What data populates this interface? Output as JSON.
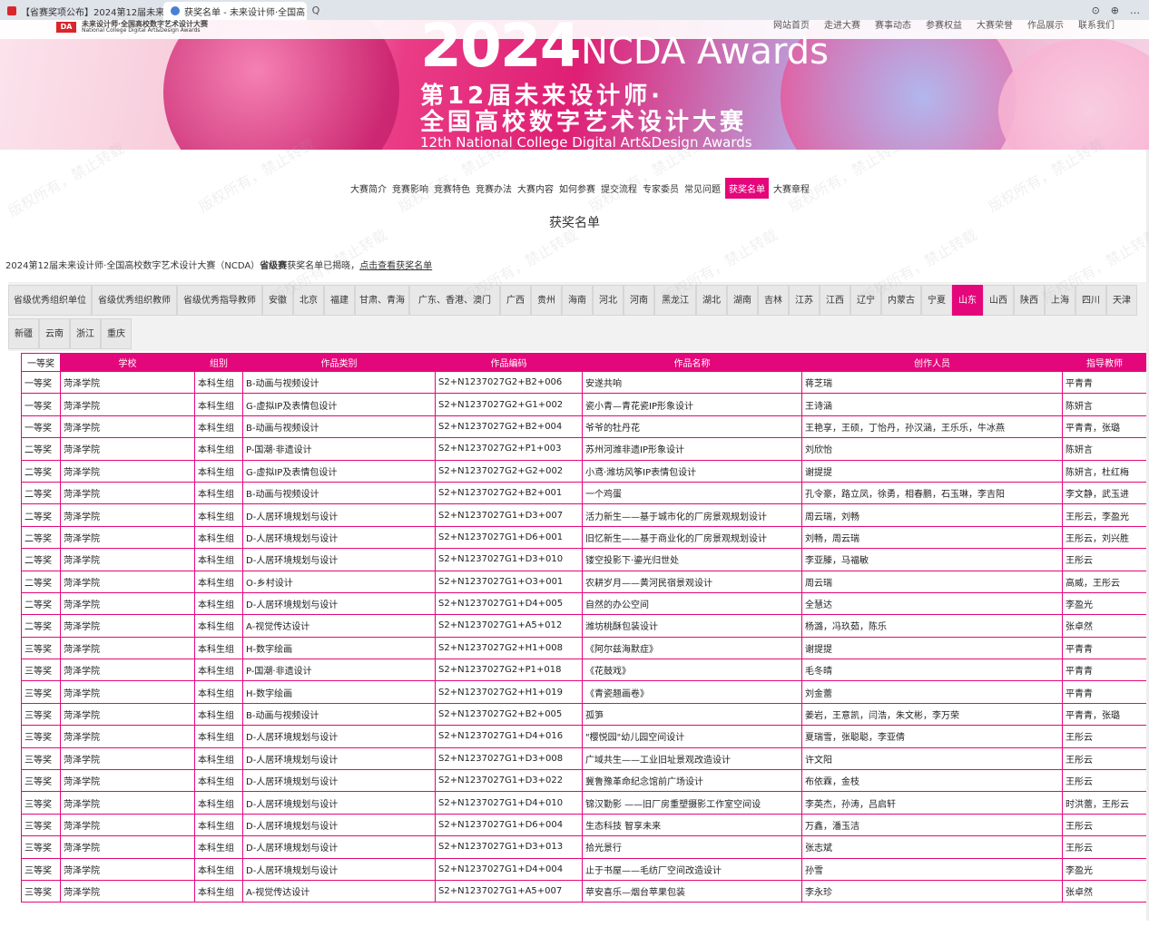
{
  "browser": {
    "tabs": [
      {
        "title": "【省赛奖项公布】2024第12届未来"
      },
      {
        "title": "获奖名单 - 未来设计师·全国高"
      }
    ],
    "close_glyph": "×",
    "search_glyph": "Q",
    "right_glyphs": [
      "⊙",
      "⊕",
      "…"
    ]
  },
  "site": {
    "logo_abbr": "DA",
    "logo_cn": "未来设计师·全国高校数字艺术设计大赛",
    "logo_en": "National College Digital Art&Design Awards",
    "nav": [
      "网站首页",
      "走进大赛",
      "赛事动态",
      "参赛权益",
      "大赛荣誉",
      "作品展示",
      "联系我们"
    ]
  },
  "banner": {
    "year": "2024",
    "awards_word": "NCDA Awards",
    "title_line1": "第12届未来设计师·",
    "title_line2": "全国高校数字艺术设计大赛",
    "title_line3": "12th National College Digital Art&Design Awards"
  },
  "subnav": {
    "items": [
      "大赛简介",
      "竞赛影响",
      "竞赛特色",
      "竞赛办法",
      "大赛内容",
      "如何参赛",
      "提交流程",
      "专家委员",
      "常见问题",
      "获奖名单",
      "大赛章程"
    ],
    "active": "获奖名单"
  },
  "page_title": "获奖名单",
  "notice": {
    "prefix": "2024第12届未来设计师·全国高校数字艺术设计大赛（NCDA）",
    "bold": "省级赛",
    "suffix": "获奖名单已揭晓，",
    "link": "点击查看获奖名单"
  },
  "provinces": {
    "row1": [
      "省级优秀组织单位",
      "省级优秀组织教师",
      "省级优秀指导教师",
      "安徽",
      "北京",
      "福建",
      "甘肃、青海",
      "广东、香港、澳门",
      "广西",
      "贵州",
      "海南",
      "河北",
      "河南",
      "黑龙江",
      "湖北",
      "湖南",
      "吉林",
      "江苏",
      "江西",
      "辽宁",
      "内蒙古",
      "宁夏",
      "山东",
      "山西",
      "陕西",
      "上海",
      "四川",
      "天津"
    ],
    "row2": [
      "新疆",
      "云南",
      "浙江",
      "重庆"
    ],
    "active": "山东"
  },
  "table": {
    "first_header": "一等奖",
    "headers": [
      "学校",
      "组别",
      "作品类别",
      "作品编码",
      "作品名称",
      "创作人员",
      "指导教师"
    ],
    "rows": [
      [
        "一等奖",
        "菏泽学院",
        "本科生组",
        "B-动画与视频设计",
        "S2+N1237027G2+B2+006",
        "安遂共响",
        "蒋芝瑞",
        "平青青"
      ],
      [
        "一等奖",
        "菏泽学院",
        "本科生组",
        "G-虚拟IP及表情包设计",
        "S2+N1237027G2+G1+002",
        "瓷小青—青花瓷IP形象设计",
        "王诗涵",
        "陈妍言"
      ],
      [
        "一等奖",
        "菏泽学院",
        "本科生组",
        "B-动画与视频设计",
        "S2+N1237027G2+B2+004",
        "爷爷的牡丹花",
        "王艳享，王硕，丁怡丹，孙汉涵，王乐乐，牛冰燕",
        "平青青，张璐"
      ],
      [
        "二等奖",
        "菏泽学院",
        "本科生组",
        "P-国潮·非遗设计",
        "S2+N1237027G2+P1+003",
        "苏州河潍非遗IP形象设计",
        "刘欣怡",
        "陈妍言"
      ],
      [
        "二等奖",
        "菏泽学院",
        "本科生组",
        "G-虚拟IP及表情包设计",
        "S2+N1237027G2+G2+002",
        "小鸢·潍坊风筝IP表情包设计",
        "谢提提",
        "陈妍言，杜红梅"
      ],
      [
        "二等奖",
        "菏泽学院",
        "本科生组",
        "B-动画与视频设计",
        "S2+N1237027G2+B2+001",
        "一个鸡蛋",
        "孔令豪，路立凤，徐勇，相春鹏，石玉琳，李吉阳",
        "李文静，武玉进"
      ],
      [
        "二等奖",
        "菏泽学院",
        "本科生组",
        "D-人居环境规划与设计",
        "S2+N1237027G1+D3+007",
        "活力新生——基于城市化的厂房景观规划设计",
        "周云瑞，刘畅",
        "王彤云，李盈光"
      ],
      [
        "二等奖",
        "菏泽学院",
        "本科生组",
        "D-人居环境规划与设计",
        "S2+N1237027G1+D6+001",
        "旧忆新生——基于商业化的厂房景观规划设计",
        "刘畅，周云瑞",
        "王彤云，刘兴胜"
      ],
      [
        "二等奖",
        "菏泽学院",
        "本科生组",
        "D-人居环境规划与设计",
        "S2+N1237027G1+D3+010",
        "镂空投影下·鎏光归世处",
        "李亚滕，马福敏",
        "王彤云"
      ],
      [
        "二等奖",
        "菏泽学院",
        "本科生组",
        "O-乡村设计",
        "S2+N1237027G1+O3+001",
        "农耕岁月——黄河民宿景观设计",
        "周云瑞",
        "高威，王彤云"
      ],
      [
        "二等奖",
        "菏泽学院",
        "本科生组",
        "D-人居环境规划与设计",
        "S2+N1237027G1+D4+005",
        "自然的办公空间",
        "全慧达",
        "李盈光"
      ],
      [
        "二等奖",
        "菏泽学院",
        "本科生组",
        "A-视觉传达设计",
        "S2+N1237027G1+A5+012",
        "潍坊桃酥包装设计",
        "杨潞，冯玖茹，陈乐",
        "张卓然"
      ],
      [
        "三等奖",
        "菏泽学院",
        "本科生组",
        "H-数字绘画",
        "S2+N1237027G2+H1+008",
        "《阿尔兹海默症》",
        "谢提提",
        "平青青"
      ],
      [
        "三等奖",
        "菏泽学院",
        "本科生组",
        "P-国潮·非遗设计",
        "S2+N1237027G2+P1+018",
        "《花鼓戏》",
        "毛冬晴",
        "平青青"
      ],
      [
        "三等奖",
        "菏泽学院",
        "本科生组",
        "H-数字绘画",
        "S2+N1237027G2+H1+019",
        "《青瓷翘画卷》",
        "刘金蕾",
        "平青青"
      ],
      [
        "三等奖",
        "菏泽学院",
        "本科生组",
        "B-动画与视频设计",
        "S2+N1237027G2+B2+005",
        "孤笋",
        "姜岩，王意凯，闫浩，朱文彬，李万荣",
        "平青青，张璐"
      ],
      [
        "三等奖",
        "菏泽学院",
        "本科生组",
        "D-人居环境规划与设计",
        "S2+N1237027G1+D4+016",
        "\"樱悦园\"幼儿园空间设计",
        "夏瑞雪，张聪聪，李亚倩",
        "王彤云"
      ],
      [
        "三等奖",
        "菏泽学院",
        "本科生组",
        "D-人居环境规划与设计",
        "S2+N1237027G1+D3+008",
        "广域共生——工业旧址景观改造设计",
        "许文阳",
        "王彤云"
      ],
      [
        "三等奖",
        "菏泽学院",
        "本科生组",
        "D-人居环境规划与设计",
        "S2+N1237027G1+D3+022",
        "冀鲁豫革命纪念馆前广场设计",
        "布依霖，金枝",
        "王彤云"
      ],
      [
        "三等奖",
        "菏泽学院",
        "本科生组",
        "D-人居环境规划与设计",
        "S2+N1237027G1+D4+010",
        "锦汉勤影 ——旧厂房重塑摄影工作室空间设",
        "李英杰，孙涛，吕启轩",
        "时洪蕾，王彤云"
      ],
      [
        "三等奖",
        "菏泽学院",
        "本科生组",
        "D-人居环境规划与设计",
        "S2+N1237027G1+D6+004",
        "生态科技 智享未来",
        "万鑫，潘玉洁",
        "王彤云"
      ],
      [
        "三等奖",
        "菏泽学院",
        "本科生组",
        "D-人居环境规划与设计",
        "S2+N1237027G1+D3+013",
        "拾光景行",
        "张志斌",
        "王彤云"
      ],
      [
        "三等奖",
        "菏泽学院",
        "本科生组",
        "D-人居环境规划与设计",
        "S2+N1237027G1+D4+004",
        "止于书屋——毛纺厂空间改造设计",
        "孙雪",
        "李盈光"
      ],
      [
        "三等奖",
        "菏泽学院",
        "本科生组",
        "A-视觉传达设计",
        "S2+N1237027G1+A5+007",
        "苹安喜乐—烟台苹果包装",
        "李永珍",
        "张卓然"
      ]
    ]
  },
  "watermark_text": "版权所有，禁止转载",
  "colors": {
    "accent": "#e4077b",
    "tab_bar": "#dfe3ea"
  }
}
